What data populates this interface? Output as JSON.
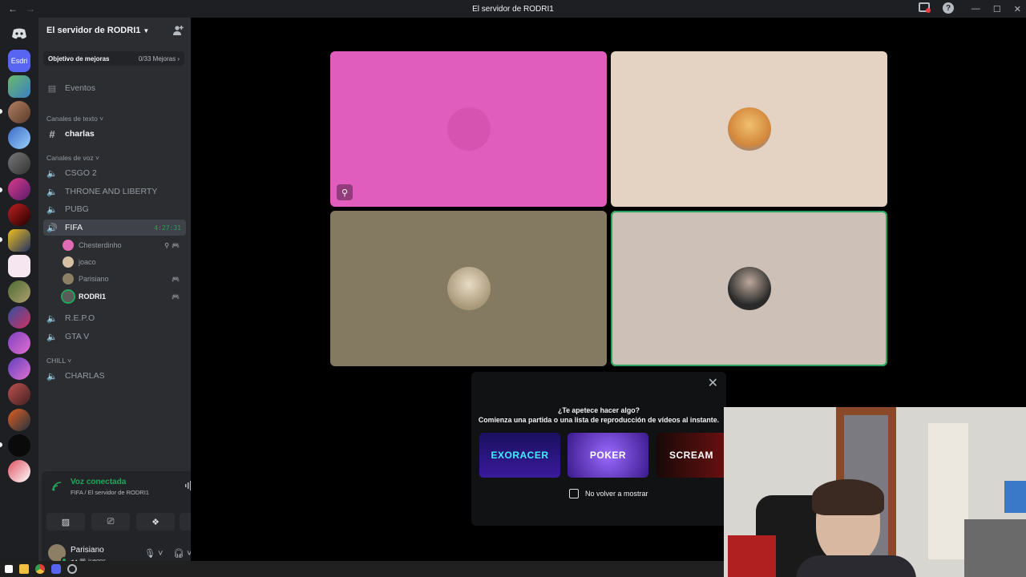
{
  "window": {
    "title": "El servidor de RODRI1",
    "back": "←",
    "forward": "→",
    "minimize": "—",
    "maximize": "☐",
    "close": "✕"
  },
  "server": {
    "name": "El servidor de RODRI1",
    "boost_goal": "Objetivo de mejoras",
    "boost_count": "0/33 Mejoras",
    "folder_label": "Esdri"
  },
  "events": "Eventos",
  "categories": {
    "text": "Canales de texto",
    "voice": "Canales de voz",
    "chill": "CHILL"
  },
  "channels": {
    "charlas": "charlas",
    "csgo": "CSGO 2",
    "throne": "THRONE AND LIBERTY",
    "pubg": "PUBG",
    "fifa": "FIFA",
    "fifa_timer": "4:27:31",
    "repo": "R.E.P.O",
    "gta": "GTA V",
    "charlas2": "CHARLAS"
  },
  "members": [
    {
      "name": "Chesterdinho",
      "color": "#e06bb4"
    },
    {
      "name": "joaco",
      "color": "#d6c1a7"
    },
    {
      "name": "Parisiano",
      "color": "#8c7f66"
    },
    {
      "name": "RODRI1",
      "color": "#5b5b5b"
    }
  ],
  "voice": {
    "status": "Voz conectada",
    "location": "FIFA / El servidor de RODRI1"
  },
  "user": {
    "name": "Parisiano",
    "status": "juegos"
  },
  "tiles": [
    {
      "color": "#e05cbd",
      "avatar": "#c04f9f"
    },
    {
      "color": "#e4d3c2",
      "avatar": "#e8b04a"
    },
    {
      "color": "#847a62",
      "avatar": "#c9b9a0"
    },
    {
      "color": "#cdc0b6",
      "avatar": "#3a3a3a"
    }
  ],
  "activity": {
    "question": "¿Te apetece hacer algo?",
    "description": "Comienza una partida o una lista de reproducción de vídeos al instante.",
    "games": [
      "EXORACER",
      "POKER",
      "SCREAM"
    ],
    "dont_show": "No volver a mostrar"
  },
  "colors": {
    "accent": "#5865f2",
    "green": "#23a55a",
    "sidebar": "#2b2d31",
    "rail": "#1e1f22"
  },
  "icons": {
    "discord": "discord-icon",
    "invite": "add-user-icon",
    "settings": "gear-icon",
    "mic": "mic-icon",
    "headset": "headset-icon"
  }
}
